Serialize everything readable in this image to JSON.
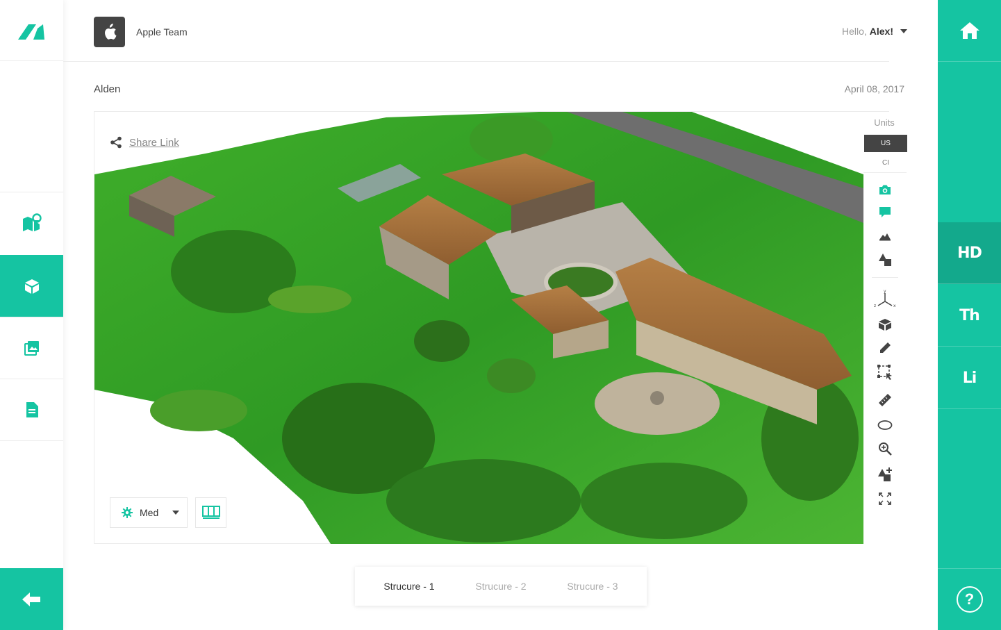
{
  "header": {
    "team_name": "Apple Team",
    "greeting_prefix": "Hello,",
    "user_name": "Alex!"
  },
  "project": {
    "name": "Alden",
    "date": "April 08, 2017"
  },
  "viewer": {
    "share_label": "Share Link",
    "quality_value": "Med",
    "units_label": "Units",
    "unit_options": [
      "US",
      "CI"
    ],
    "selected_unit": "US",
    "tools": [
      "camera-icon",
      "comment-icon",
      "terrain-icon",
      "shapes-icon",
      "axis-icon",
      "cube-icon",
      "pencil-icon",
      "select-icon",
      "ruler-icon",
      "ellipse-icon",
      "zoom-in-icon",
      "add-shape-icon",
      "fullscreen-icon"
    ]
  },
  "left_nav": [
    "logo-icon",
    "map-pin-icon",
    "cube-icon",
    "gallery-icon",
    "document-icon",
    "back-arrow-icon"
  ],
  "right_nav": {
    "items": [
      "HD",
      "Th",
      "Li"
    ],
    "active": "HD"
  },
  "structures": {
    "tabs": [
      "Strucure - 1",
      "Strucure - 2",
      "Strucure - 3"
    ],
    "active_index": 0
  },
  "colors": {
    "accent": "#15c4a2",
    "accent_dark": "#13a98c",
    "dark": "#444444"
  }
}
